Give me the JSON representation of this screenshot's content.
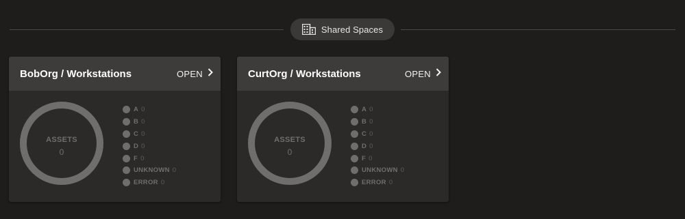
{
  "section": {
    "title": "Shared Spaces",
    "icon": "building-icon"
  },
  "colors": {
    "background": "#1e1d1c",
    "card": "#2b2a29",
    "card_header": "#3d3c3b",
    "muted": "#6f6e6d"
  },
  "cards": [
    {
      "title": "BobOrg / Workstations",
      "open_label": "OPEN",
      "donut": {
        "label": "ASSETS",
        "count": "0"
      },
      "legend": [
        {
          "grade": "A",
          "count": "0"
        },
        {
          "grade": "B",
          "count": "0"
        },
        {
          "grade": "C",
          "count": "0"
        },
        {
          "grade": "D",
          "count": "0"
        },
        {
          "grade": "F",
          "count": "0"
        },
        {
          "grade": "UNKNOWN",
          "count": "0"
        },
        {
          "grade": "ERROR",
          "count": "0"
        }
      ]
    },
    {
      "title": "CurtOrg / Workstations",
      "open_label": "OPEN",
      "donut": {
        "label": "ASSETS",
        "count": "0"
      },
      "legend": [
        {
          "grade": "A",
          "count": "0"
        },
        {
          "grade": "B",
          "count": "0"
        },
        {
          "grade": "C",
          "count": "0"
        },
        {
          "grade": "D",
          "count": "0"
        },
        {
          "grade": "F",
          "count": "0"
        },
        {
          "grade": "UNKNOWN",
          "count": "0"
        },
        {
          "grade": "ERROR",
          "count": "0"
        }
      ]
    }
  ]
}
